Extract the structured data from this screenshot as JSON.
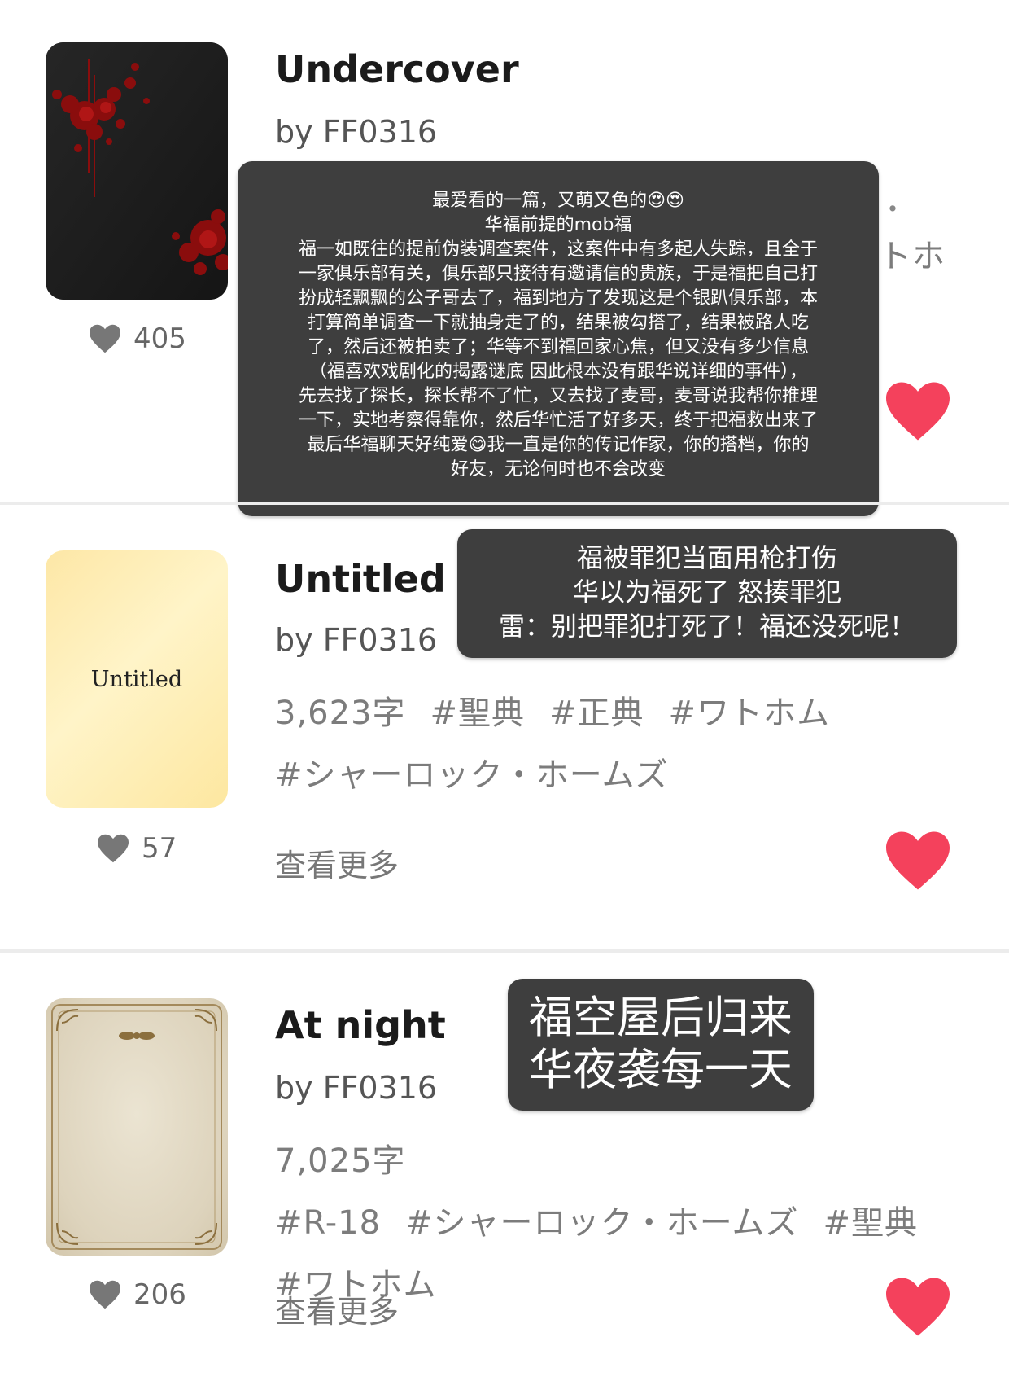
{
  "works": [
    {
      "title": "Undercover",
      "author": "by FF0316",
      "likes": "405",
      "partial_tags_right": "トホ",
      "partial_dot": "・"
    },
    {
      "title": "Untitled",
      "author": "by FF0316",
      "cover_text": "Untitled",
      "tags": [
        "3,623字",
        "#聖典",
        "#正典",
        "#ワトホム",
        "#シャーロック・ホームズ"
      ],
      "see_more": "查看更多",
      "likes": "57"
    },
    {
      "title": "At night",
      "author": "by FF0316",
      "tags": [
        "7,025字",
        "#R-18",
        "#シャーロック・ホームズ",
        "#聖典",
        "#ワトホム"
      ],
      "see_more": "查看更多",
      "likes": "206"
    }
  ],
  "notes": {
    "undercover": [
      "最爱看的一篇，又萌又色的😍😍",
      "华福前提的mob福",
      "福一如既往的提前伪装调查案件，这案件中有多起人失踪，且全于",
      "一家俱乐部有关，俱乐部只接待有邀请信的贵族，于是福把自己打",
      "扮成轻飘飘的公子哥去了，福到地方了发现这是个银趴俱乐部，本",
      "打算简单调查一下就抽身走了的，结果被勾搭了，结果被路人吃",
      "了，然后还被拍卖了；华等不到福回家心焦，但又没有多少信息",
      "（福喜欢戏剧化的揭露谜底 因此根本没有跟华说详细的事件），",
      "先去找了探长，探长帮不了忙，又去找了麦哥，麦哥说我帮你推理",
      "一下，实地考察得靠你，然后华忙活了好多天，终于把福救出来了",
      "最后华福聊天好纯爱😋我一直是你的传记作家，你的搭档，你的",
      "好友，无论何时也不会改变"
    ],
    "untitled": [
      "福被罪犯当面用枪打伤",
      "华以为福死了 怒揍罪犯",
      "雷：别把罪犯打死了！福还没死呢！"
    ],
    "at_night": [
      "福空屋后归来",
      "华夜袭每一天"
    ]
  },
  "colors": {
    "heart": "#f4415c",
    "note_bg": "#3e3e3e",
    "like_icon": "#777777"
  }
}
